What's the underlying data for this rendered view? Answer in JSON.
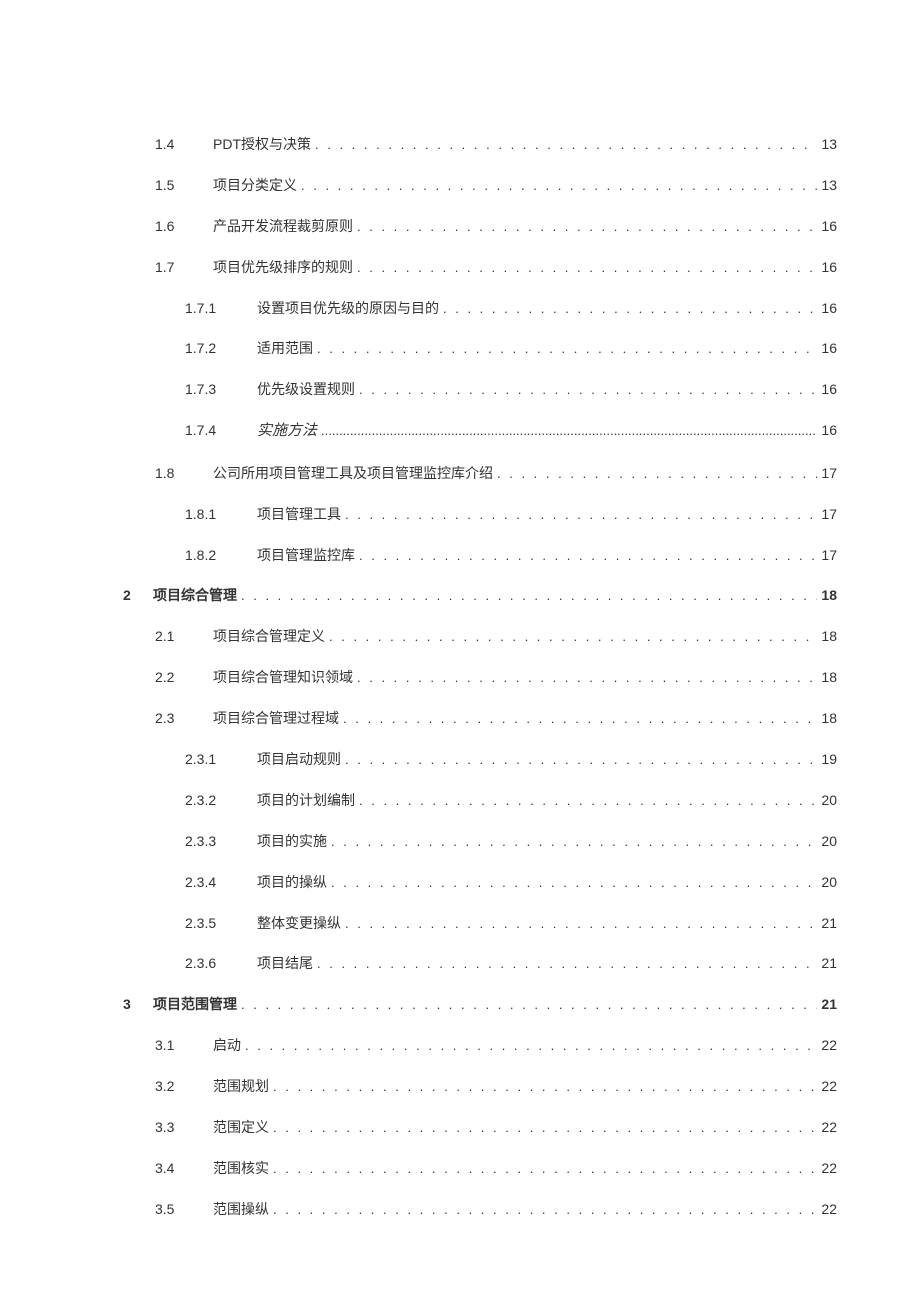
{
  "toc": [
    {
      "level": 1,
      "num": "1.4",
      "title": "PDT授权与决策",
      "page": "13",
      "bold": false,
      "italic": false
    },
    {
      "level": 1,
      "num": "1.5",
      "title": "项目分类定义",
      "page": "13",
      "bold": false,
      "italic": false
    },
    {
      "level": 1,
      "num": "1.6",
      "title": "产品开发流程裁剪原则",
      "page": "16",
      "bold": false,
      "italic": false
    },
    {
      "level": 1,
      "num": "1.7",
      "title": "项目优先级排序的规则",
      "page": "16",
      "bold": false,
      "italic": false
    },
    {
      "level": 2,
      "num": "1.7.1",
      "title": "设置项目优先级的原因与目的",
      "page": "16",
      "bold": false,
      "italic": false
    },
    {
      "level": 2,
      "num": "1.7.2",
      "title": "适用范围",
      "page": "16",
      "bold": false,
      "italic": false
    },
    {
      "level": 2,
      "num": "1.7.3",
      "title": "优先级设置规则",
      "page": "16",
      "bold": false,
      "italic": false
    },
    {
      "level": 2,
      "num": "1.7.4",
      "title": "实施方法",
      "page": "16",
      "bold": false,
      "italic": true
    },
    {
      "level": 1,
      "num": "1.8",
      "title": "公司所用项目管理工具及项目管理监控库介绍",
      "page": "17",
      "bold": false,
      "italic": false
    },
    {
      "level": 2,
      "num": "1.8.1",
      "title": "项目管理工具",
      "page": "17",
      "bold": false,
      "italic": false
    },
    {
      "level": 2,
      "num": "1.8.2",
      "title": "项目管理监控库",
      "page": "17",
      "bold": false,
      "italic": false
    },
    {
      "level": 0,
      "num": "2",
      "title": "项目综合管理",
      "page": "18",
      "bold": true,
      "italic": false
    },
    {
      "level": 1,
      "num": "2.1",
      "title": "项目综合管理定义",
      "page": "18",
      "bold": false,
      "italic": false
    },
    {
      "level": 1,
      "num": "2.2",
      "title": "项目综合管理知识领域",
      "page": "18",
      "bold": false,
      "italic": false
    },
    {
      "level": 1,
      "num": "2.3",
      "title": "项目综合管理过程域",
      "page": "18",
      "bold": false,
      "italic": false
    },
    {
      "level": 2,
      "num": "2.3.1",
      "title": "项目启动规则",
      "page": "19",
      "bold": false,
      "italic": false
    },
    {
      "level": 2,
      "num": "2.3.2",
      "title": "项目的计划编制",
      "page": "20",
      "bold": false,
      "italic": false
    },
    {
      "level": 2,
      "num": "2.3.3",
      "title": "项目的实施",
      "page": "20",
      "bold": false,
      "italic": false
    },
    {
      "level": 2,
      "num": "2.3.4",
      "title": "项目的操纵",
      "page": "20",
      "bold": false,
      "italic": false
    },
    {
      "level": 2,
      "num": "2.3.5",
      "title": "整体变更操纵",
      "page": "21",
      "bold": false,
      "italic": false
    },
    {
      "level": 2,
      "num": "2.3.6",
      "title": "项目结尾",
      "page": "21",
      "bold": false,
      "italic": false
    },
    {
      "level": 0,
      "num": "3",
      "title": "项目范围管理",
      "page": "21",
      "bold": true,
      "italic": false
    },
    {
      "level": 1,
      "num": "3.1",
      "title": "启动",
      "page": "22",
      "bold": false,
      "italic": false
    },
    {
      "level": 1,
      "num": "3.2",
      "title": "范围规划",
      "page": "22",
      "bold": false,
      "italic": false
    },
    {
      "level": 1,
      "num": "3.3",
      "title": "范围定义",
      "page": "22",
      "bold": false,
      "italic": false
    },
    {
      "level": 1,
      "num": "3.4",
      "title": "范围核实",
      "page": "22",
      "bold": false,
      "italic": false
    },
    {
      "level": 1,
      "num": "3.5",
      "title": "范围操纵",
      "page": "22",
      "bold": false,
      "italic": false
    }
  ]
}
